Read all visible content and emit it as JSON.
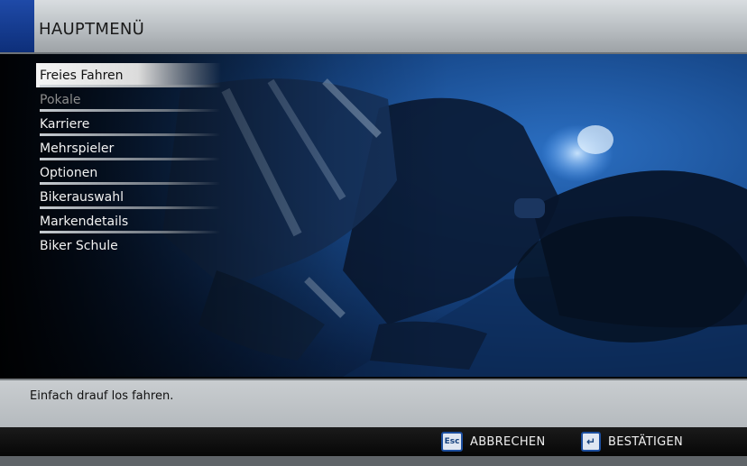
{
  "header": {
    "title": "HAUPTMENÜ"
  },
  "menu": {
    "items": [
      {
        "label": "Freies Fahren",
        "state": "selected"
      },
      {
        "label": "Pokale",
        "state": "disabled"
      },
      {
        "label": "Karriere",
        "state": "normal"
      },
      {
        "label": "Mehrspieler",
        "state": "normal"
      },
      {
        "label": "Optionen",
        "state": "normal"
      },
      {
        "label": "Bikerauswahl",
        "state": "normal"
      },
      {
        "label": "Markendetails",
        "state": "normal"
      },
      {
        "label": "Biker Schule",
        "state": "normal"
      }
    ]
  },
  "info": {
    "description": "Einfach drauf los fahren."
  },
  "footer": {
    "cancel": {
      "key": "Esc",
      "label": "ABBRECHEN",
      "icon": "esc-key-icon"
    },
    "confirm": {
      "key": "↵",
      "label": "BESTÄTIGEN",
      "icon": "enter-key-icon"
    }
  },
  "colors": {
    "accent_blue": "#1f4aa8",
    "header_gray": "#c2c6c9",
    "scene_blue": "#184a8d",
    "footer_black": "#0a0a0a"
  }
}
